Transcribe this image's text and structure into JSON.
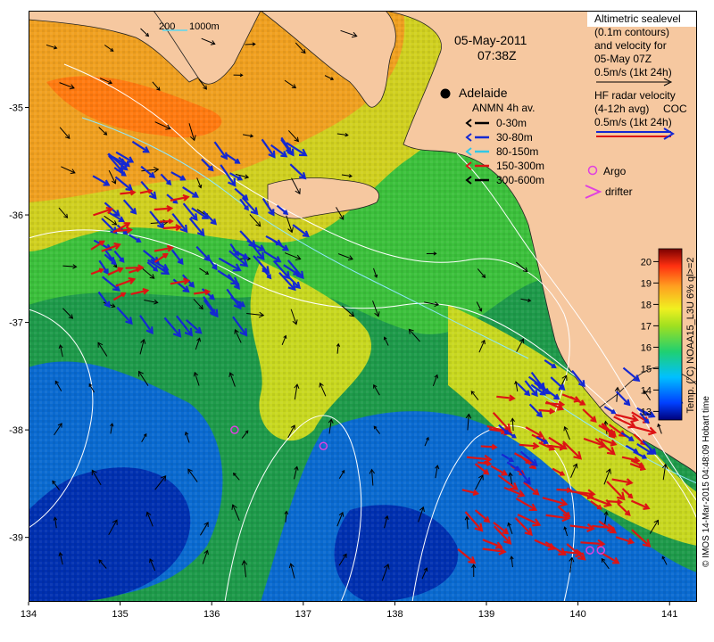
{
  "map": {
    "date": "05-May-2011",
    "time": "07:38Z",
    "place_label": "Adelaide",
    "scale_bar": {
      "depth1": "200",
      "depth2": "1000m"
    },
    "x_ticks": [
      "134",
      "135",
      "136",
      "137",
      "138",
      "139",
      "140",
      "141"
    ],
    "y_ticks": [
      "-35",
      "-36",
      "-37",
      "-38",
      "-39"
    ],
    "lon_range": [
      134,
      141.3
    ],
    "lat_range": [
      -39.6,
      -34.1
    ]
  },
  "legend": {
    "altimetry": [
      "Altimetric sealevel",
      "(0.1m contours)",
      "and velocity for",
      "05-May 07Z",
      "0.5m/s (1kt 24h)"
    ],
    "hf_radar": [
      "HF radar velocity",
      "(4-12h avg)",
      "0.5m/s (1kt 24h)"
    ],
    "hf_radar_tag": "COC",
    "anmn_title": "ANMN 4h av.",
    "anmn_items": [
      {
        "label": "0-30m",
        "color": "#000000"
      },
      {
        "label": "30-80m",
        "color": "#1428d2"
      },
      {
        "label": "80-150m",
        "color": "#32c8e6"
      },
      {
        "label": "150-300m",
        "color": "#dc1414"
      },
      {
        "label": "300-600m",
        "color": "#000000"
      }
    ],
    "argo_label": "Argo",
    "drifter_label": "drifter"
  },
  "colorbar": {
    "ticks": [
      "13",
      "14",
      "15",
      "16",
      "17",
      "18",
      "19",
      "20"
    ],
    "min": 12.6,
    "max": 20.6,
    "label": "Temp. (°C) NOAA15_L3U 6% ql>=2"
  },
  "credit": "© IMOS 14-Mar-2015 04:48:09 Hobart time",
  "colors": {
    "land": "#f6c8a0",
    "contour": "#ffffff",
    "argo": "#e040e0"
  },
  "argo_floats": [
    {
      "lon": 136.25,
      "lat": -38.0
    },
    {
      "lon": 137.22,
      "lat": -38.15
    },
    {
      "lon": 140.13,
      "lat": -39.12
    },
    {
      "lon": 140.25,
      "lat": -39.12
    }
  ]
}
